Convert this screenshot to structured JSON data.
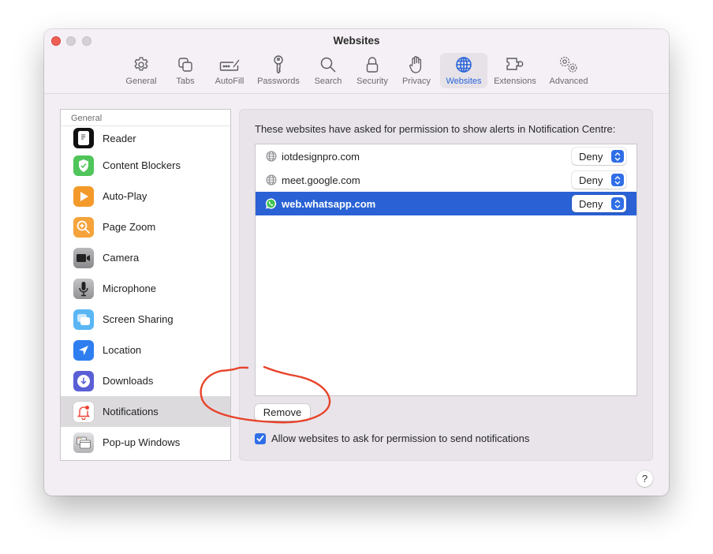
{
  "window": {
    "title": "Websites",
    "controls": [
      "close",
      "minimize",
      "zoom"
    ]
  },
  "toolbar": {
    "items": [
      {
        "label": "General",
        "icon": "gear-icon"
      },
      {
        "label": "Tabs",
        "icon": "tabs-icon"
      },
      {
        "label": "AutoFill",
        "icon": "autofill-icon"
      },
      {
        "label": "Passwords",
        "icon": "key-icon"
      },
      {
        "label": "Search",
        "icon": "search-icon"
      },
      {
        "label": "Security",
        "icon": "lock-icon"
      },
      {
        "label": "Privacy",
        "icon": "hand-icon"
      },
      {
        "label": "Websites",
        "icon": "globe-icon",
        "active": true
      },
      {
        "label": "Extensions",
        "icon": "puzzle-icon"
      },
      {
        "label": "Advanced",
        "icon": "gears-icon"
      }
    ],
    "accent_color": "#2a64d8"
  },
  "sidebar": {
    "section_header": "General",
    "items": [
      {
        "label": "Reader",
        "icon": "reader-icon"
      },
      {
        "label": "Content Blockers",
        "icon": "shield-icon"
      },
      {
        "label": "Auto-Play",
        "icon": "play-icon"
      },
      {
        "label": "Page Zoom",
        "icon": "zoom-icon"
      },
      {
        "label": "Camera",
        "icon": "camera-icon"
      },
      {
        "label": "Microphone",
        "icon": "microphone-icon"
      },
      {
        "label": "Screen Sharing",
        "icon": "screen-sharing-icon"
      },
      {
        "label": "Location",
        "icon": "location-icon"
      },
      {
        "label": "Downloads",
        "icon": "download-icon"
      },
      {
        "label": "Notifications",
        "icon": "bell-icon",
        "selected": true
      },
      {
        "label": "Pop-up Windows",
        "icon": "popup-windows-icon"
      }
    ]
  },
  "main": {
    "description": "These websites have asked for permission to show alerts in Notification Centre:",
    "sites": [
      {
        "name": "iotdesignpro.com",
        "icon": "globe-icon",
        "permission": "Deny"
      },
      {
        "name": "meet.google.com",
        "icon": "globe-icon",
        "permission": "Deny"
      },
      {
        "name": "web.whatsapp.com",
        "icon": "whatsapp-icon",
        "permission": "Deny",
        "selected": true
      }
    ],
    "remove_label": "Remove",
    "allow_checkbox": {
      "label": "Allow websites to ask for permission to send notifications",
      "checked": true
    },
    "help_label": "?",
    "selection_color": "#2a62d5",
    "annotation_color": "#e8432a"
  }
}
